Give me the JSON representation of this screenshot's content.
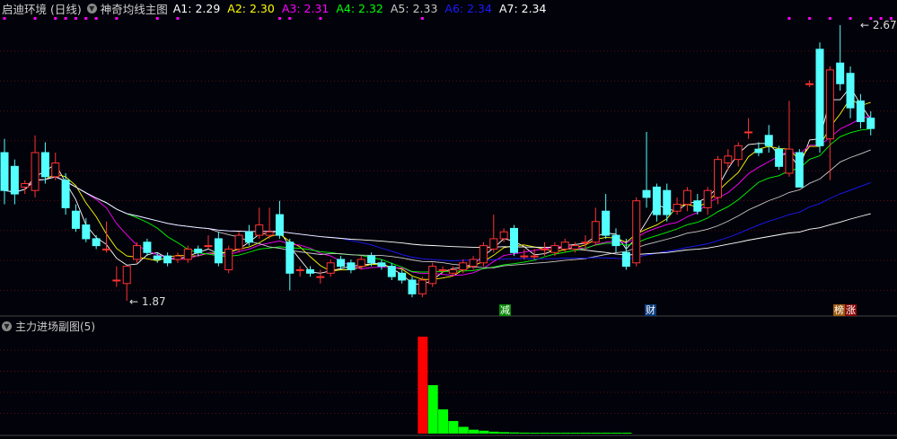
{
  "header": {
    "stock": "启迪环境 (日线)",
    "indicator": "神奇均线主图",
    "ma_labels": [
      {
        "label": "A1:",
        "value": "2.29",
        "color": "#ffffff"
      },
      {
        "label": "A2:",
        "value": "2.30",
        "color": "#ffff00"
      },
      {
        "label": "A3:",
        "value": "2.31",
        "color": "#ff00ff"
      },
      {
        "label": "A4:",
        "value": "2.32",
        "color": "#00ff00"
      },
      {
        "label": "A5:",
        "value": "2.33",
        "color": "#c8c8c8"
      },
      {
        "label": "A6:",
        "value": "2.34",
        "color": "#1a1aff"
      },
      {
        "label": "A7:",
        "value": "2.34",
        "color": "#ffffff"
      }
    ]
  },
  "sub_header": {
    "title": "主力进场副图(5)"
  },
  "annotations": {
    "high_label": "2.67",
    "low_label": "1.87",
    "tag_jian": "减",
    "tag_cai": "财",
    "tag_bang": "榜",
    "tag_zhang": "涨"
  },
  "colors": {
    "up": "#ff3232",
    "down": "#54ffff",
    "bg": "#02020a",
    "grid": "#5a0f0f",
    "hist_first": "#ff0000",
    "hist": "#00ff00",
    "marker": "#ff00ff"
  },
  "chart_data": {
    "type": "candlestick",
    "ylim": [
      1.84,
      2.72
    ],
    "candles": [
      [
        2.3,
        2.34,
        2.15,
        2.19
      ],
      [
        2.26,
        2.28,
        2.15,
        2.18
      ],
      [
        2.2,
        2.22,
        2.18,
        2.21
      ],
      [
        2.19,
        2.35,
        2.17,
        2.3
      ],
      [
        2.3,
        2.33,
        2.21,
        2.23
      ],
      [
        2.23,
        2.3,
        2.22,
        2.27
      ],
      [
        2.22,
        2.24,
        2.12,
        2.14
      ],
      [
        2.13,
        2.15,
        2.07,
        2.08
      ],
      [
        2.09,
        2.11,
        2.04,
        2.05
      ],
      [
        2.05,
        2.06,
        2.02,
        2.03
      ],
      [
        2.02,
        2.1,
        2.01,
        2.02
      ],
      [
        1.93,
        1.97,
        1.91,
        1.93
      ],
      [
        1.92,
        1.97,
        1.87,
        1.97
      ],
      [
        1.99,
        2.04,
        1.98,
        2.03
      ],
      [
        2.04,
        2.05,
        2.0,
        2.01
      ],
      [
        2.0,
        2.01,
        1.98,
        1.99
      ],
      [
        2.0,
        2.01,
        1.97,
        1.98
      ],
      [
        1.99,
        2.01,
        1.98,
        2.0
      ],
      [
        1.99,
        2.03,
        1.98,
        2.02
      ],
      [
        2.02,
        2.03,
        2.0,
        2.01
      ],
      [
        2.03,
        2.06,
        2.02,
        2.03
      ],
      [
        2.05,
        2.07,
        1.97,
        1.98
      ],
      [
        1.96,
        2.03,
        1.95,
        2.02
      ],
      [
        2.02,
        2.07,
        2.01,
        2.06
      ],
      [
        2.07,
        2.09,
        2.03,
        2.04
      ],
      [
        2.06,
        2.14,
        2.05,
        2.09
      ],
      [
        2.06,
        2.14,
        2.05,
        2.07
      ],
      [
        2.12,
        2.16,
        2.05,
        2.06
      ],
      [
        2.04,
        2.05,
        1.9,
        1.95
      ],
      [
        1.96,
        1.97,
        1.94,
        1.96
      ],
      [
        1.96,
        1.97,
        1.94,
        1.95
      ],
      [
        1.94,
        1.96,
        1.92,
        1.94
      ],
      [
        1.95,
        1.99,
        1.94,
        1.98
      ],
      [
        1.99,
        2.0,
        1.96,
        1.97
      ],
      [
        1.98,
        1.99,
        1.95,
        1.96
      ],
      [
        1.97,
        2.0,
        1.96,
        1.99
      ],
      [
        2.0,
        2.01,
        1.97,
        1.98
      ],
      [
        1.98,
        1.99,
        1.96,
        1.97
      ],
      [
        1.97,
        1.98,
        1.93,
        1.94
      ],
      [
        1.95,
        1.96,
        1.92,
        1.93
      ],
      [
        1.93,
        1.94,
        1.88,
        1.89
      ],
      [
        1.89,
        1.94,
        1.88,
        1.93
      ],
      [
        1.92,
        1.98,
        1.91,
        1.97
      ],
      [
        1.96,
        1.97,
        1.95,
        1.96
      ],
      [
        1.95,
        1.97,
        1.94,
        1.96
      ],
      [
        1.96,
        1.99,
        1.95,
        1.98
      ],
      [
        1.97,
        2.0,
        1.96,
        1.99
      ],
      [
        1.98,
        2.04,
        1.97,
        2.03
      ],
      [
        2.02,
        2.12,
        2.01,
        2.05
      ],
      [
        2.05,
        2.08,
        2.04,
        2.07
      ],
      [
        2.08,
        2.09,
        2.0,
        2.01
      ],
      [
        2.0,
        2.02,
        1.99,
        2.0
      ],
      [
        2.0,
        2.02,
        1.99,
        2.0
      ],
      [
        2.02,
        2.04,
        2.0,
        2.02
      ],
      [
        2.01,
        2.04,
        2.0,
        2.03
      ],
      [
        2.02,
        2.05,
        2.01,
        2.04
      ],
      [
        2.02,
        2.04,
        2.01,
        2.03
      ],
      [
        2.04,
        2.06,
        2.02,
        2.04
      ],
      [
        2.04,
        2.14,
        2.03,
        2.1
      ],
      [
        2.13,
        2.18,
        2.05,
        2.06
      ],
      [
        2.06,
        2.08,
        2.01,
        2.03
      ],
      [
        2.01,
        2.05,
        1.96,
        1.97
      ],
      [
        1.98,
        2.17,
        1.97,
        2.16
      ],
      [
        2.19,
        2.36,
        2.14,
        2.17
      ],
      [
        2.2,
        2.21,
        2.1,
        2.12
      ],
      [
        2.19,
        2.21,
        2.1,
        2.12
      ],
      [
        2.13,
        2.17,
        2.12,
        2.15
      ],
      [
        2.15,
        2.2,
        2.13,
        2.19
      ],
      [
        2.16,
        2.18,
        2.12,
        2.13
      ],
      [
        2.14,
        2.2,
        2.12,
        2.19
      ],
      [
        2.17,
        2.29,
        2.15,
        2.28
      ],
      [
        2.27,
        2.31,
        2.25,
        2.29
      ],
      [
        2.28,
        2.33,
        2.26,
        2.32
      ],
      [
        2.36,
        2.4,
        2.34,
        2.36
      ],
      [
        2.31,
        2.33,
        2.29,
        2.3
      ],
      [
        2.35,
        2.38,
        2.3,
        2.32
      ],
      [
        2.31,
        2.32,
        2.25,
        2.26
      ],
      [
        2.24,
        2.45,
        2.23,
        2.31
      ],
      [
        2.3,
        2.31,
        2.2,
        2.2
      ],
      [
        2.5,
        2.51,
        2.49,
        2.5
      ],
      [
        2.6,
        2.62,
        2.3,
        2.32
      ],
      [
        2.34,
        2.55,
        2.22,
        2.54
      ],
      [
        2.56,
        2.67,
        2.48,
        2.5
      ],
      [
        2.53,
        2.55,
        2.4,
        2.43
      ],
      [
        2.45,
        2.47,
        2.37,
        2.39
      ],
      [
        2.4,
        2.42,
        2.35,
        2.37
      ]
    ],
    "ma_periods": [
      3,
      5,
      8,
      13,
      21,
      34,
      55
    ],
    "top_markers": [
      0,
      3,
      5,
      6,
      7,
      8,
      9,
      11,
      15,
      17,
      27,
      28,
      31,
      41,
      77,
      79,
      81,
      83,
      85,
      86,
      87,
      88
    ],
    "histogram": {
      "start_index": 41,
      "values": [
        100,
        50,
        25,
        13,
        7,
        4,
        3,
        2,
        1.5,
        1.2,
        1,
        0.8,
        0.6,
        0.5,
        0.4,
        0.3,
        0.3,
        0.2,
        0.2,
        0.2,
        0.1
      ]
    }
  }
}
